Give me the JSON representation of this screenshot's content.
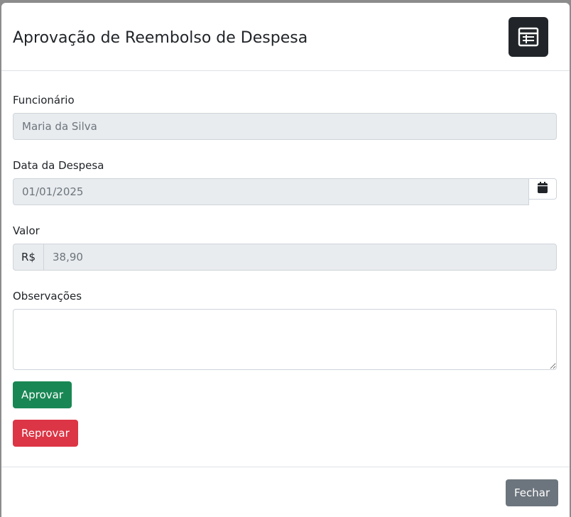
{
  "modal": {
    "title": "Aprovação de Reembolso de Despesa",
    "header_icon": "checklist-icon"
  },
  "form": {
    "employee": {
      "label": "Funcionário",
      "value": "Maria da Silva"
    },
    "expense_date": {
      "label": "Data da Despesa",
      "value": "01/01/2025",
      "button_icon": "calendar-icon"
    },
    "amount": {
      "label": "Valor",
      "currency_prefix": "R$",
      "value": "38,90"
    },
    "notes": {
      "label": "Observações",
      "value": ""
    }
  },
  "actions": {
    "approve_label": "Aprovar",
    "reject_label": "Reprovar"
  },
  "footer": {
    "close_label": "Fechar"
  },
  "colors": {
    "approve": "#198754",
    "reject": "#dc3545",
    "close": "#6c757d",
    "header_icon_bg": "#212529",
    "readonly_bg": "#e9ecef"
  }
}
